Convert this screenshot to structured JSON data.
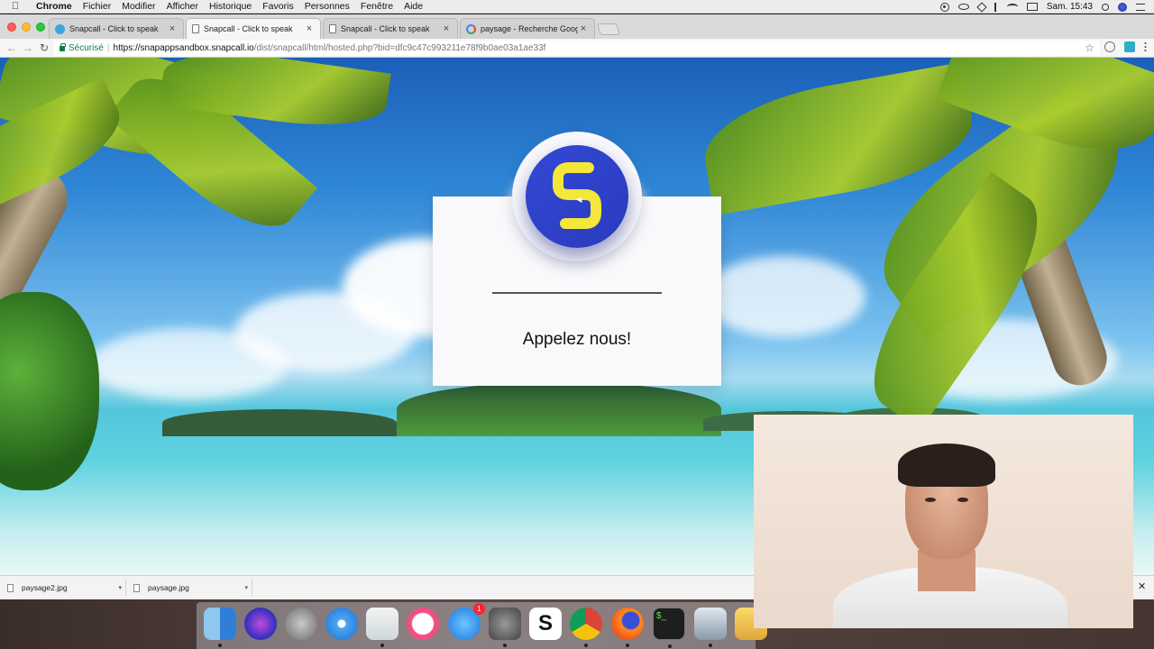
{
  "menubar": {
    "app_name": "Chrome",
    "items": [
      "Fichier",
      "Modifier",
      "Afficher",
      "Historique",
      "Favoris",
      "Personnes",
      "Fenêtre",
      "Aide"
    ],
    "clock": "Sam. 15:43"
  },
  "tabs": [
    {
      "title": "Snapcall - Click to speak",
      "favicon": "snapcall-icon",
      "active": false
    },
    {
      "title": "Snapcall - Click to speak",
      "favicon": "document-icon",
      "active": true
    },
    {
      "title": "Snapcall - Click to speak",
      "favicon": "document-icon",
      "active": false
    },
    {
      "title": "paysage - Recherche Google",
      "favicon": "google-icon",
      "active": false
    }
  ],
  "address_bar": {
    "security_label": "Sécurisé",
    "url_host": "https://snapappsandbox.snapcall.io",
    "url_path": "/dist/snapcall/html/hosted.php?bid=dfc9c47c993211e78f9b0ae03a1ae33f"
  },
  "page": {
    "card_title": "Appelez nous!",
    "logo_color": "#3347d2",
    "logo_accent": "#f5e63a"
  },
  "downloads": [
    {
      "filename": "paysage2.jpg"
    },
    {
      "filename": "paysage.jpg"
    }
  ],
  "dock": {
    "apps": [
      "finder-icon",
      "siri-icon",
      "launchpad-icon",
      "safari-icon",
      "preview-icon",
      "itunes-icon",
      "app-store-icon",
      "system-preferences-icon",
      "snapcall-s-icon",
      "chrome-icon",
      "firefox-icon",
      "terminal-icon",
      "photo-icon",
      "folder-icon"
    ],
    "app_store_badge": "1"
  }
}
